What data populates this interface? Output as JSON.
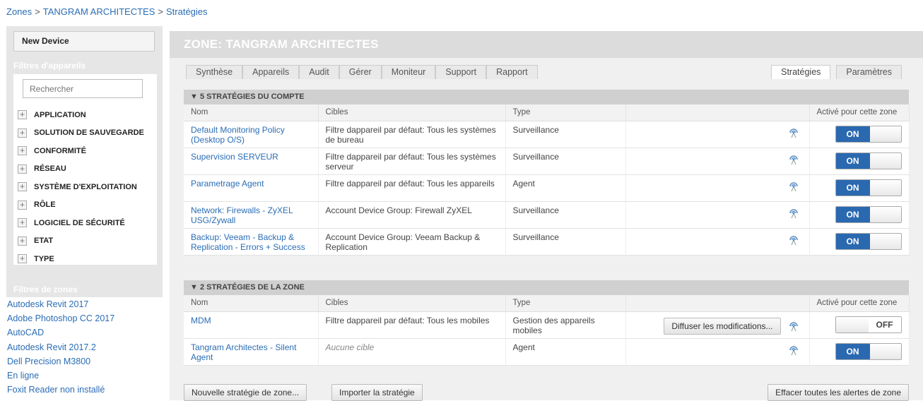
{
  "breadcrumb": [
    "Zones",
    "TANGRAM ARCHITECTES",
    "Stratégies"
  ],
  "breadcrumb_sep": ">",
  "sidebar": {
    "new_device": "New Device",
    "device_filters_title": "Filtres d'appareils",
    "search_placeholder": "Rechercher",
    "filters": [
      "APPLICATION",
      "SOLUTION DE SAUVEGARDE",
      "CONFORMITÉ",
      "RÉSEAU",
      "SYSTÈME D'EXPLOITATION",
      "RÔLE",
      "LOGICIEL DE SÉCURITÉ",
      "ETAT",
      "TYPE"
    ],
    "zone_filters_title": "Filtres de zones",
    "zone_filters": [
      "Autodesk Revit 2017",
      "Adobe Photoshop CC 2017",
      "AutoCAD",
      "Autodesk Revit 2017.2",
      "Dell Precision M3800",
      "En ligne",
      "Foxit Reader non installé"
    ]
  },
  "zone_title": "ZONE: TANGRAM ARCHITECTES",
  "tabs_left": [
    "Synthèse",
    "Appareils",
    "Audit",
    "Gérer",
    "Moniteur",
    "Support",
    "Rapport"
  ],
  "tabs_right": [
    "Stratégies",
    "Paramètres"
  ],
  "columns": {
    "name": "Nom",
    "targets": "Cibles",
    "type": "Type",
    "enabled": "Activé pour cette zone"
  },
  "account_section": {
    "title": "▼ 5 STRATÉGIES DU COMPTE",
    "rows": [
      {
        "name": "Default Monitoring Policy (Desktop O/S)",
        "targets": "Filtre dappareil par défaut: Tous les systèmes de bureau",
        "type": "Surveillance",
        "state": "ON"
      },
      {
        "name": "Supervision SERVEUR",
        "targets": "Filtre dappareil par défaut: Tous les systèmes serveur",
        "type": "Surveillance",
        "state": "ON"
      },
      {
        "name": "Parametrage Agent",
        "targets": "Filtre dappareil par défaut: Tous les appareils",
        "type": "Agent",
        "state": "ON"
      },
      {
        "name": "Network: Firewalls - ZyXEL USG/Zywall",
        "targets": "Account Device Group: Firewall ZyXEL",
        "type": "Surveillance",
        "state": "ON"
      },
      {
        "name": "Backup: Veeam - Backup & Replication - Errors + Success",
        "targets": "Account Device Group: Veeam Backup & Replication",
        "type": "Surveillance",
        "state": "ON"
      }
    ]
  },
  "zone_section": {
    "title": "▼ 2 STRATÉGIES DE LA ZONE",
    "rows": [
      {
        "name": "MDM",
        "targets": "Filtre dappareil par défaut: Tous les mobiles",
        "type": "Gestion des appareils mobiles",
        "action": "Diffuser les modifications...",
        "state": "OFF"
      },
      {
        "name": "Tangram Architectes - Silent Agent",
        "targets": "Aucune cible",
        "type": "Agent",
        "state": "ON"
      }
    ]
  },
  "buttons": {
    "new_zone_policy": "Nouvelle stratégie de zone...",
    "import_policy": "Importer la stratégie",
    "clear_alerts": "Effacer toutes les alertes de zone"
  },
  "colors": {
    "accent": "#2a69b0",
    "link": "#2a6db5"
  },
  "icons": {
    "push": "signal-icon",
    "expand": "plus-icon"
  }
}
